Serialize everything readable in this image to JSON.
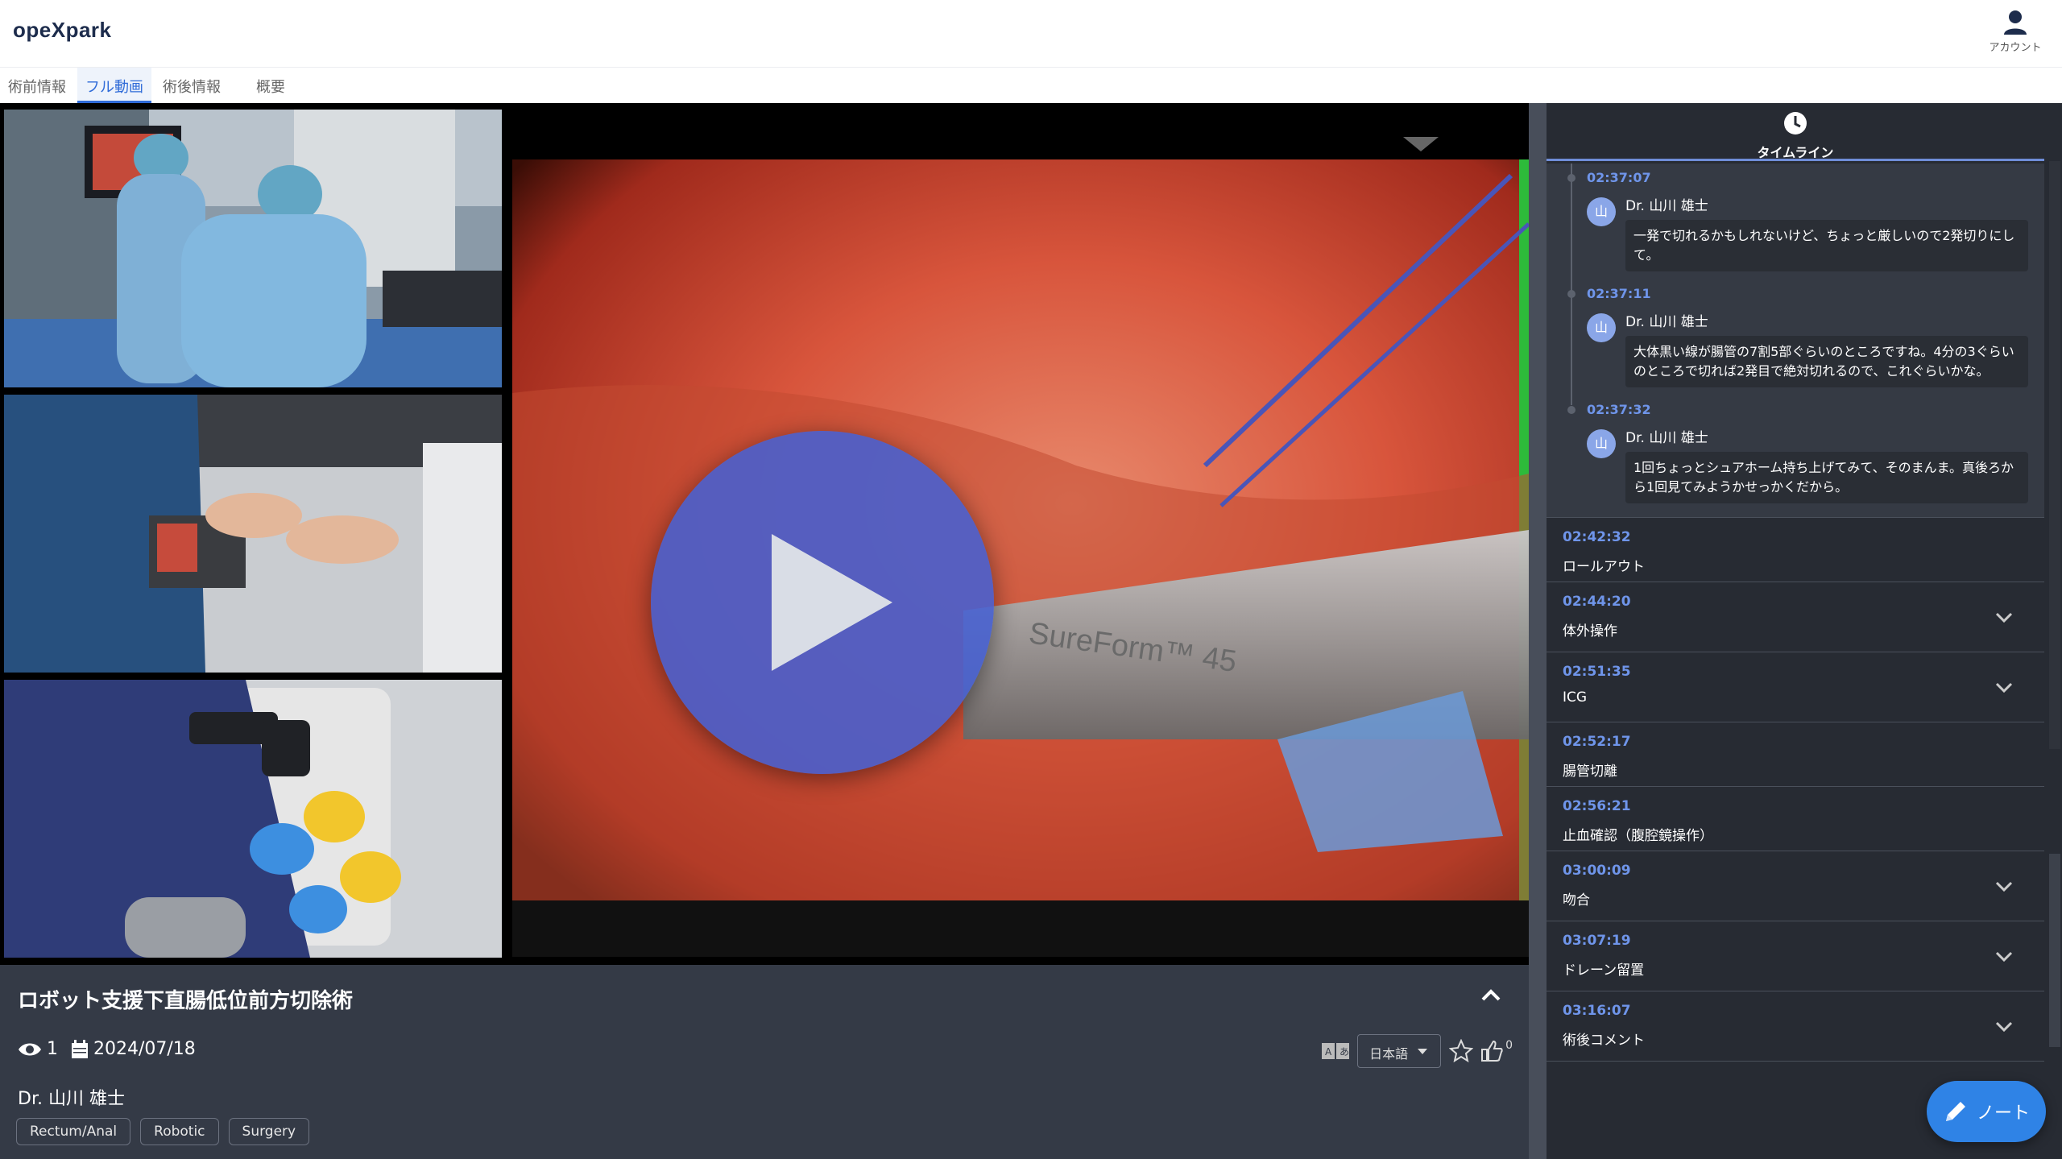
{
  "header": {
    "logo": "opeXpark",
    "account_label": "アカウント"
  },
  "tabs": [
    {
      "label": "術前情報",
      "active": false
    },
    {
      "label": "フル動画",
      "active": true
    },
    {
      "label": "術後情報",
      "active": false
    },
    {
      "label": "概要",
      "active": false
    }
  ],
  "video": {
    "title": "ロボット支援下直腸低位前方切除術",
    "views": "1",
    "date": "2024/07/18",
    "surgeon": "Dr. 山川 雄士",
    "tags": [
      "Rectum/Anal",
      "Robotic",
      "Surgery"
    ],
    "language": "日本語",
    "likes": "0",
    "instrument_text": "SureForm™ 45"
  },
  "timeline": {
    "header_label": "タイムライン",
    "comments": [
      {
        "time": "02:37:07",
        "avatar": "山",
        "author": "Dr. 山川 雄士",
        "text": "一発で切れるかもしれないけど、ちょっと厳しいので2発切りにして。"
      },
      {
        "time": "02:37:11",
        "avatar": "山",
        "author": "Dr. 山川 雄士",
        "text": "大体黒い線が腸管の7割5部ぐらいのところですね。4分の3ぐらいのところで切れば2発目で絶対切れるので、これぐらいかな。"
      },
      {
        "time": "02:37:32",
        "avatar": "山",
        "author": "Dr. 山川 雄士",
        "text": "1回ちょっとシュアホーム持ち上げてみて、そのまんま。真後ろから1回見てみようかせっかくだから。"
      }
    ],
    "items": [
      {
        "time": "02:42:32",
        "label": "ロールアウト",
        "expandable": false
      },
      {
        "time": "02:44:20",
        "label": "体外操作",
        "expandable": true
      },
      {
        "time": "02:51:35",
        "label": "ICG",
        "expandable": true
      },
      {
        "time": "02:52:17",
        "label": "腸管切離",
        "expandable": false
      },
      {
        "time": "02:56:21",
        "label": "止血確認（腹腔鏡操作）",
        "expandable": false
      },
      {
        "time": "03:00:09",
        "label": "吻合",
        "expandable": true
      },
      {
        "time": "03:07:19",
        "label": "ドレーン留置",
        "expandable": true
      },
      {
        "time": "03:16:07",
        "label": "術後コメント",
        "expandable": true
      }
    ]
  },
  "note_button": {
    "label": "ノート"
  },
  "colors": {
    "accent": "#2f6bd8",
    "timestamp": "#6f95ea",
    "play": "#4660d2",
    "note": "#2f83e6"
  },
  "icons": [
    "account-icon",
    "eye-icon",
    "calendar-icon",
    "translate-icon",
    "star-icon",
    "thumbs-up-icon",
    "clock-icon",
    "chevron-down-icon",
    "chevron-up-icon",
    "pencil-icon",
    "play-icon"
  ]
}
